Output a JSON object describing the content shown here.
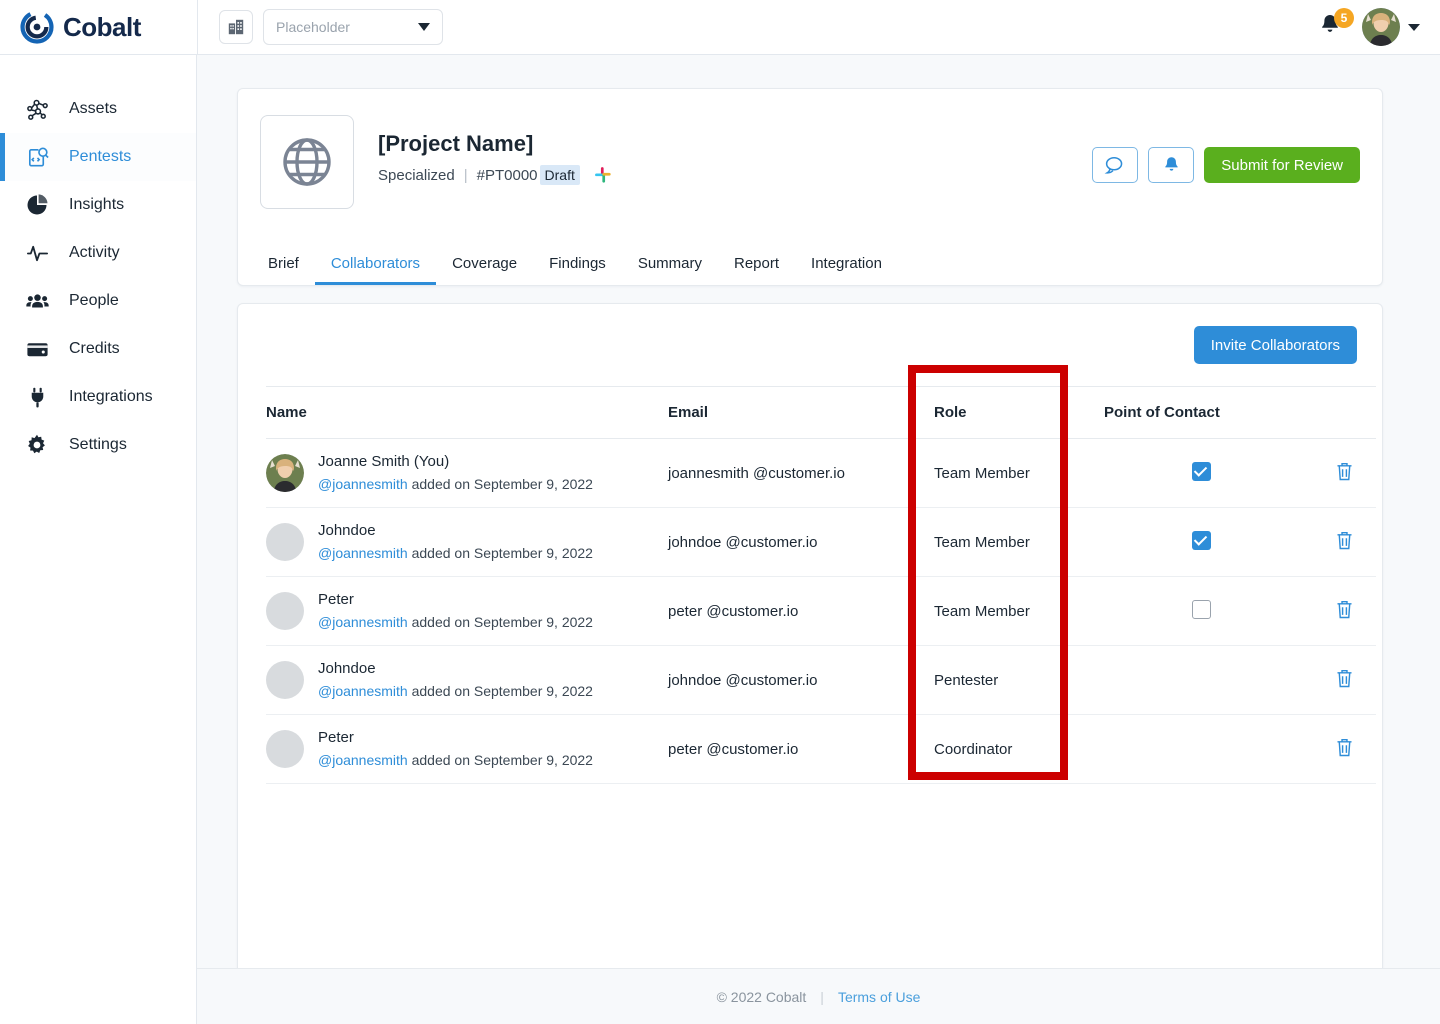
{
  "topbar": {
    "brand": "Cobalt",
    "org_icon": "building-icon",
    "org_select_value": "Placeholder",
    "notifications_count": "5",
    "bell_icon": "bell-icon",
    "avatar_icon": "user-avatar"
  },
  "sidebar": {
    "items": [
      {
        "label": "Assets",
        "icon": "assets-network-icon",
        "active": false
      },
      {
        "label": "Pentests",
        "icon": "pentests-code-search-icon",
        "active": true
      },
      {
        "label": "Insights",
        "icon": "insights-piechart-icon",
        "active": false
      },
      {
        "label": "Activity",
        "icon": "activity-pulse-icon",
        "active": false
      },
      {
        "label": "People",
        "icon": "people-group-icon",
        "active": false
      },
      {
        "label": "Credits",
        "icon": "credits-wallet-icon",
        "active": false
      },
      {
        "label": "Integrations",
        "icon": "integrations-plug-icon",
        "active": false
      },
      {
        "label": "Settings",
        "icon": "settings-gear-icon",
        "active": false
      }
    ]
  },
  "project": {
    "icon": "globe-icon",
    "title": "[Project Name]",
    "type": "Specialized",
    "separator": "|",
    "id": "#PT0000",
    "status_badge": "Draft",
    "slack_icon": "slack-icon",
    "actions": {
      "comment_icon": "comment-bubble-icon",
      "bell_icon": "bell-icon",
      "submit_label": "Submit for Review"
    }
  },
  "tabs": [
    {
      "label": "Brief",
      "active": false
    },
    {
      "label": "Collaborators",
      "active": true
    },
    {
      "label": "Coverage",
      "active": false
    },
    {
      "label": "Findings",
      "active": false
    },
    {
      "label": "Summary",
      "active": false
    },
    {
      "label": "Report",
      "active": false
    },
    {
      "label": "Integration",
      "active": false
    }
  ],
  "collaborators": {
    "invite_label": "Invite Collaborators",
    "columns": [
      "Name",
      "Email",
      "Role",
      "Point of Contact",
      ""
    ],
    "rows": [
      {
        "name": "Joanne Smith (You)",
        "handle": "@joannesmith",
        "added": " added on September 9, 2022",
        "email": "joannesmith @customer.io",
        "role": "Team Member",
        "point_of_contact": "checked",
        "avatar": "photo",
        "delete_icon": "trash-icon"
      },
      {
        "name": "Johndoe",
        "handle": "@joannesmith",
        "added": " added on September 9, 2022",
        "email": "johndoe @customer.io",
        "role": "Team Member",
        "point_of_contact": "checked",
        "avatar": "placeholder",
        "delete_icon": "trash-icon"
      },
      {
        "name": "Peter",
        "handle": "@joannesmith",
        "added": " added on September 9, 2022",
        "email": "peter @customer.io",
        "role": "Team Member",
        "point_of_contact": "unchecked",
        "avatar": "placeholder",
        "delete_icon": "trash-icon"
      },
      {
        "name": "Johndoe",
        "handle": "@joannesmith",
        "added": " added on September 9, 2022",
        "email": "johndoe @customer.io",
        "role": "Pentester",
        "point_of_contact": "none",
        "avatar": "placeholder",
        "delete_icon": "trash-icon"
      },
      {
        "name": "Peter",
        "handle": "@joannesmith",
        "added": " added on September 9, 2022",
        "email": "peter @customer.io",
        "role": "Coordinator",
        "point_of_contact": "none",
        "avatar": "placeholder",
        "delete_icon": "trash-icon"
      }
    ]
  },
  "annotation": {
    "target_column": "Role",
    "color": "#cc0000"
  },
  "footer": {
    "copyright": "© 2022 Cobalt",
    "separator": "|",
    "terms": "Terms of Use"
  },
  "colors": {
    "accent_blue": "#2e8dd8",
    "submit_green": "#5aaf1e",
    "badge_orange": "#f5a623",
    "annotation_red": "#cc0000",
    "draft_badge_bg": "#d9e8f7"
  }
}
